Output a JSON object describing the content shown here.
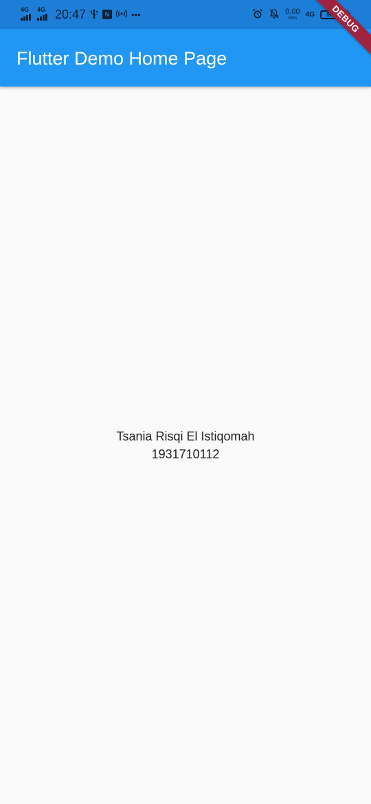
{
  "status_bar": {
    "network_1": "4G",
    "network_2": "4G",
    "time": "20:47",
    "usb_icon": "usb-icon",
    "nfc_badge": "N",
    "hotspot_icon": "hotspot-icon",
    "more": "•••",
    "alarm_icon": "alarm-icon",
    "dnd_icon": "mute-icon",
    "speed_value": "0.00",
    "speed_unit": "KB/s",
    "network_right": "4G",
    "battery_level": "96",
    "charging_icon": "bolt-icon"
  },
  "app_bar": {
    "title": "Flutter Demo Home Page",
    "color": "#2196f3"
  },
  "debug_banner": {
    "label": "DEBUG",
    "color": "#a0233f"
  },
  "body": {
    "name": "Tsania Risqi El Istiqomah",
    "id_number": "1931710112",
    "background": "#fafafa"
  }
}
